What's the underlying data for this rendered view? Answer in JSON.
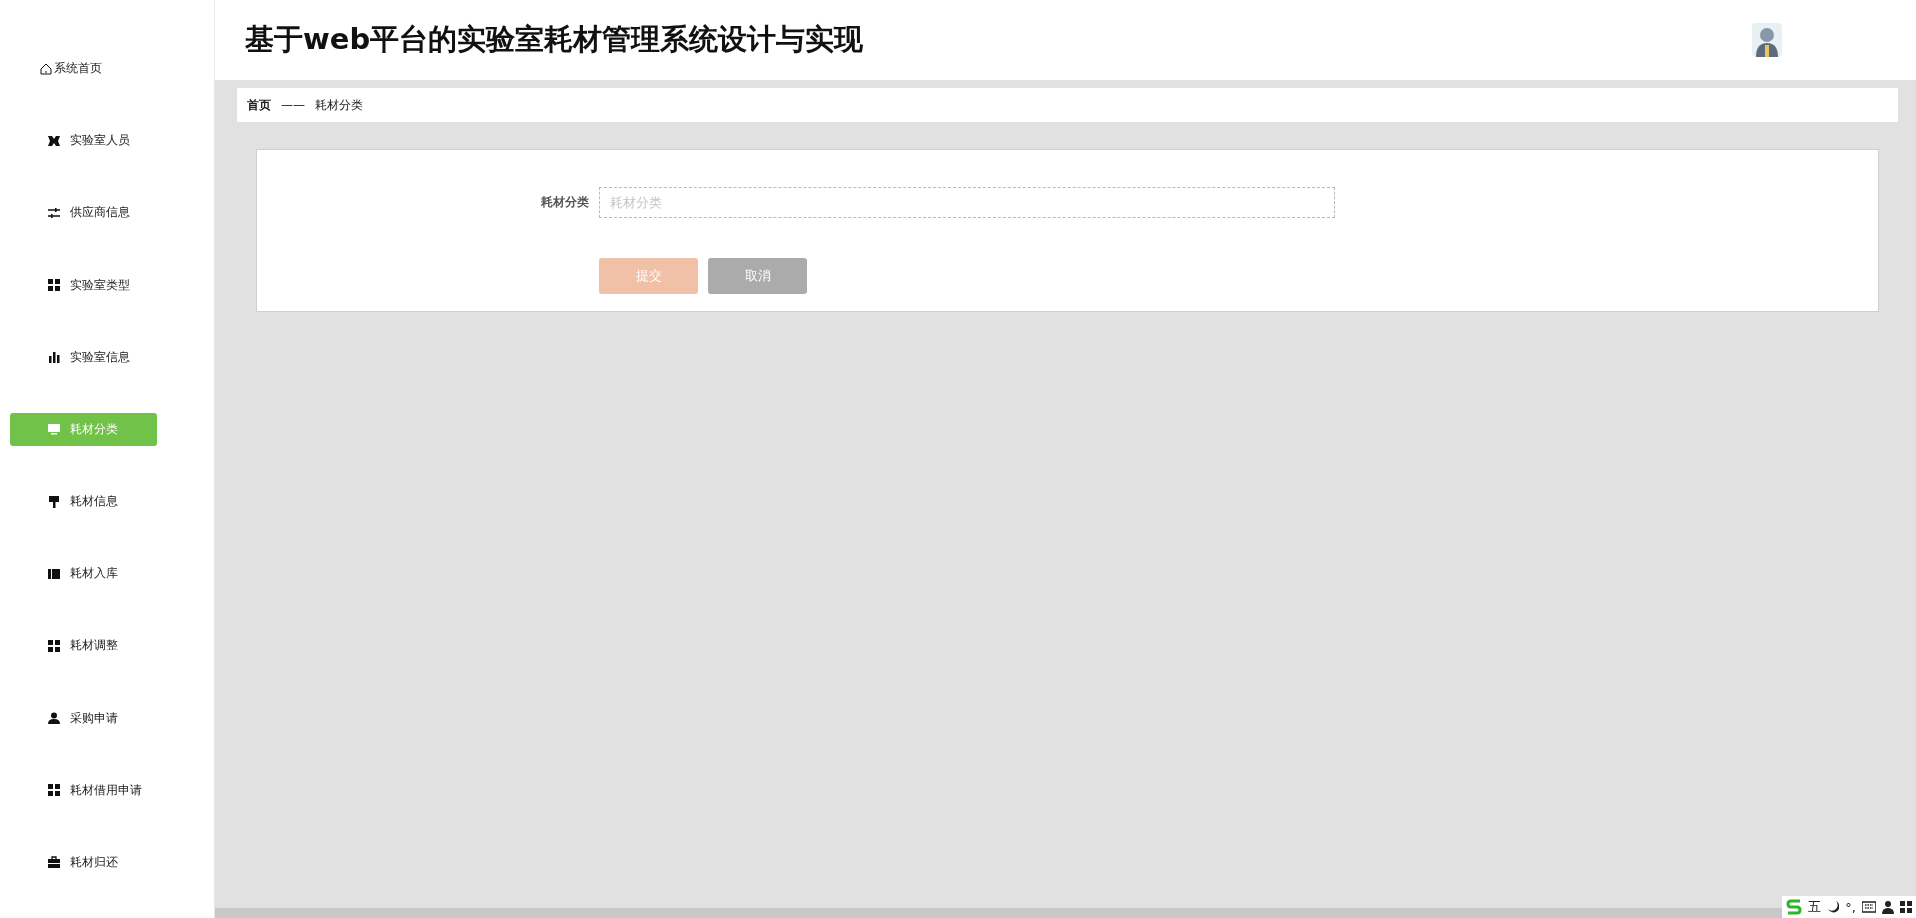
{
  "header": {
    "title": "基于web平台的实验室耗材管理系统设计与实现"
  },
  "sidebar": {
    "items": [
      {
        "label": "系统首页",
        "selected": false
      },
      {
        "label": "实验室人员",
        "selected": false
      },
      {
        "label": "供应商信息",
        "selected": false
      },
      {
        "label": "实验室类型",
        "selected": false
      },
      {
        "label": "实验室信息",
        "selected": false
      },
      {
        "label": "耗材分类",
        "selected": true
      },
      {
        "label": "耗材信息",
        "selected": false
      },
      {
        "label": "耗材入库",
        "selected": false
      },
      {
        "label": "耗材调整",
        "selected": false
      },
      {
        "label": "采购申请",
        "selected": false
      },
      {
        "label": "耗材借用申请",
        "selected": false
      },
      {
        "label": "耗材归还",
        "selected": false
      }
    ]
  },
  "breadcrumb": {
    "home": "首页",
    "separator": "——",
    "current": "耗材分类"
  },
  "form": {
    "fields": [
      {
        "label": "耗材分类",
        "placeholder": "耗材分类"
      }
    ],
    "buttons": [
      {
        "label": "提交",
        "kind": "submit"
      },
      {
        "label": "取消",
        "kind": "cancel"
      }
    ]
  },
  "ime_toolbar": {
    "mode": "五",
    "punctuation": "°,"
  }
}
